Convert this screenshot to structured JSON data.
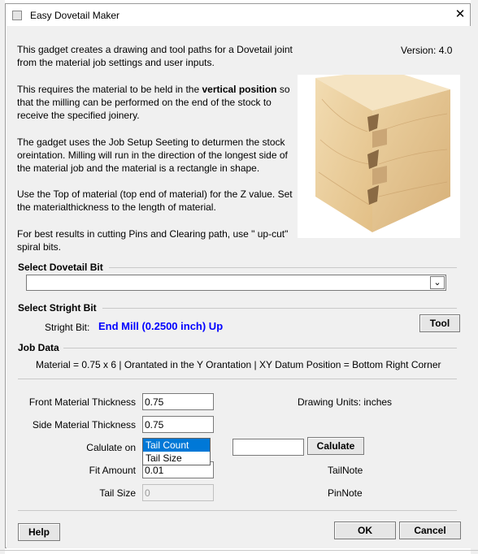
{
  "window": {
    "title": "Easy Dovetail Maker"
  },
  "intro": {
    "version": "Version: 4.0",
    "p1": "This gadget creates a drawing and tool paths for a Dovetail joint from the material job settings and user inputs.",
    "p2_pre": "This requires the material to be held in the ",
    "p2_bold": "vertical position",
    "p2_post": " so that the milling can be performed on the end of the stock to receive the specified joinery.",
    "p3": "The gadget uses the Job Setup Seeting to deturmen the stock oreintation. Milling will run in the direction of the longest side of the material job and the material is a rectangle in shape.",
    "p4": "Use the Top of material (top end of material) for the Z value. Set the materialthickness to the length of material.",
    "p5": "For best results in cutting Pins and Clearing path, use \" up-cut\" spiral bits."
  },
  "dovetail_bit": {
    "header": "Select Dovetail Bit",
    "value": ""
  },
  "stright_bit": {
    "header": "Select Stright Bit",
    "label": "Stright Bit:",
    "value": "End Mill (0.2500 inch) Up",
    "value_color": "#0000ff",
    "tool_button": "Tool"
  },
  "job_data": {
    "header": "Job Data",
    "summary": "Material = 0.75 x 6 | Orantated in the Y Orantation | XY Datum Position = Bottom Right Corner"
  },
  "form": {
    "front_label": "Front Material Thickness",
    "front_value": "0.75",
    "side_label": "Side Material Thickness",
    "side_value": "0.75",
    "drawing_units": "Drawing Units: inches",
    "calc_label": "Calulate on",
    "calc_options": [
      "Tail Count",
      "Tail Size"
    ],
    "calc_selected": "Tail Count",
    "calc_input_value": "",
    "calc_button": "Calulate",
    "fit_label": "Fit Amount",
    "fit_value": "0.01",
    "tail_note": "TailNote",
    "tail_size_label": "Tail Size",
    "tail_size_value": "0",
    "pin_note": "PinNote"
  },
  "buttons": {
    "help": "Help",
    "ok": "OK",
    "cancel": "Cancel"
  }
}
